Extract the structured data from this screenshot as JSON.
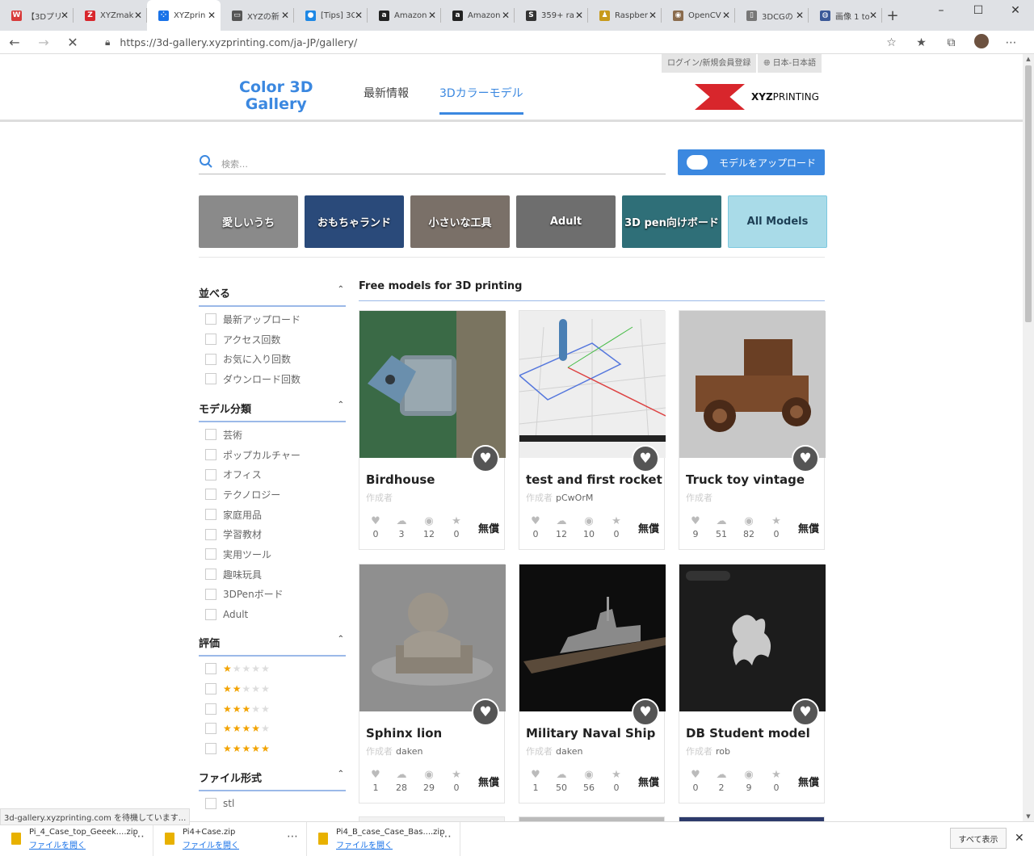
{
  "browser": {
    "tabs": [
      {
        "label": "【3Dプリ",
        "color": "#d83b3b",
        "glyph": "W"
      },
      {
        "label": "XYZmak",
        "color": "#d8262c",
        "glyph": "Z"
      },
      {
        "label": "XYZprin",
        "color": "#1a73e8",
        "glyph": "⁘",
        "active": true
      },
      {
        "label": "XYZの新",
        "color": "#555555",
        "glyph": "▭"
      },
      {
        "label": "[Tips] 3C",
        "color": "#1e88e5",
        "glyph": "●"
      },
      {
        "label": "Amazon",
        "color": "#222222",
        "glyph": "a"
      },
      {
        "label": "Amazon",
        "color": "#222222",
        "glyph": "a"
      },
      {
        "label": "359+ ra",
        "color": "#333333",
        "glyph": "S"
      },
      {
        "label": "Raspber",
        "color": "#c79a1b",
        "glyph": "♟"
      },
      {
        "label": "OpenCV",
        "color": "#8a6b4d",
        "glyph": "◉"
      },
      {
        "label": "3DCGの",
        "color": "#777777",
        "glyph": "▯"
      },
      {
        "label": "画像 1 to",
        "color": "#3b5998",
        "glyph": "◍"
      }
    ],
    "new_tab": "+",
    "url": "https://3d-gallery.xyzprinting.com/ja-JP/gallery/",
    "status": "3d-gallery.xyzprinting.com を待機しています..."
  },
  "header": {
    "login": "ログイン/新規会員登録",
    "language": "日本-日本語",
    "logo_line1": "Color 3D",
    "logo_line2": "Gallery",
    "nav_news": "最新情報",
    "nav_models": "3Dカラーモデル",
    "brand": "XYZ",
    "brand2": "PRINTING"
  },
  "search": {
    "placeholder": "検索…"
  },
  "upload_button": "モデルをアップロード",
  "categories": [
    {
      "label": "愛しいうち",
      "bg": "#8a8a8a"
    },
    {
      "label": "おもちゃランド",
      "bg": "#2a4a7a"
    },
    {
      "label": "小さいな工具",
      "bg": "#7a7068"
    },
    {
      "label": "Adult",
      "bg": "#6e6e6e"
    },
    {
      "label": "3D pen向けボード",
      "bg": "#2f6f78"
    },
    {
      "label": "All Models",
      "bg": "#a9dbe8"
    }
  ],
  "sidebar": {
    "sort": {
      "title": "並べる",
      "items": [
        "最新アップロード",
        "アクセス回数",
        "お気に入り回数",
        "ダウンロード回数"
      ]
    },
    "category": {
      "title": "モデル分類",
      "items": [
        "芸術",
        "ポップカルチャー",
        "オフィス",
        "テクノロジー",
        "家庭用品",
        "学習教材",
        "実用ツール",
        "趣味玩具",
        "3DPenボード",
        "Adult"
      ]
    },
    "rating": {
      "title": "評価",
      "items": [
        1,
        2,
        3,
        4,
        5
      ]
    },
    "format": {
      "title": "ファイル形式",
      "items": [
        "stl"
      ]
    }
  },
  "gallery": {
    "title": "Free models for 3D printing",
    "author_label": "作成者",
    "free_label": "無償",
    "cards": [
      {
        "name": "Birdhouse",
        "author": "",
        "likes": "0",
        "downloads": "3",
        "views": "12",
        "stars": "0"
      },
      {
        "name": "test and first rocket",
        "author": "pCwOrM",
        "likes": "0",
        "downloads": "12",
        "views": "10",
        "stars": "0"
      },
      {
        "name": "Truck toy vintage",
        "author": "",
        "likes": "9",
        "downloads": "51",
        "views": "82",
        "stars": "0"
      },
      {
        "name": "Sphinx lion",
        "author": "daken",
        "likes": "1",
        "downloads": "28",
        "views": "29",
        "stars": "0"
      },
      {
        "name": "Military Naval Ship",
        "author": "daken",
        "likes": "1",
        "downloads": "50",
        "views": "56",
        "stars": "0"
      },
      {
        "name": "DB Student model",
        "author": "rob",
        "likes": "0",
        "downloads": "2",
        "views": "9",
        "stars": "0"
      }
    ]
  },
  "downloads": {
    "items": [
      {
        "file": "Pi_4_Case_top_Geeek....zip",
        "open": "ファイルを開く"
      },
      {
        "file": "Pi4+Case.zip",
        "open": "ファイルを開く"
      },
      {
        "file": "Pi4_B_case_Case_Bas....zip",
        "open": "ファイルを開く"
      }
    ],
    "show_all": "すべて表示"
  }
}
